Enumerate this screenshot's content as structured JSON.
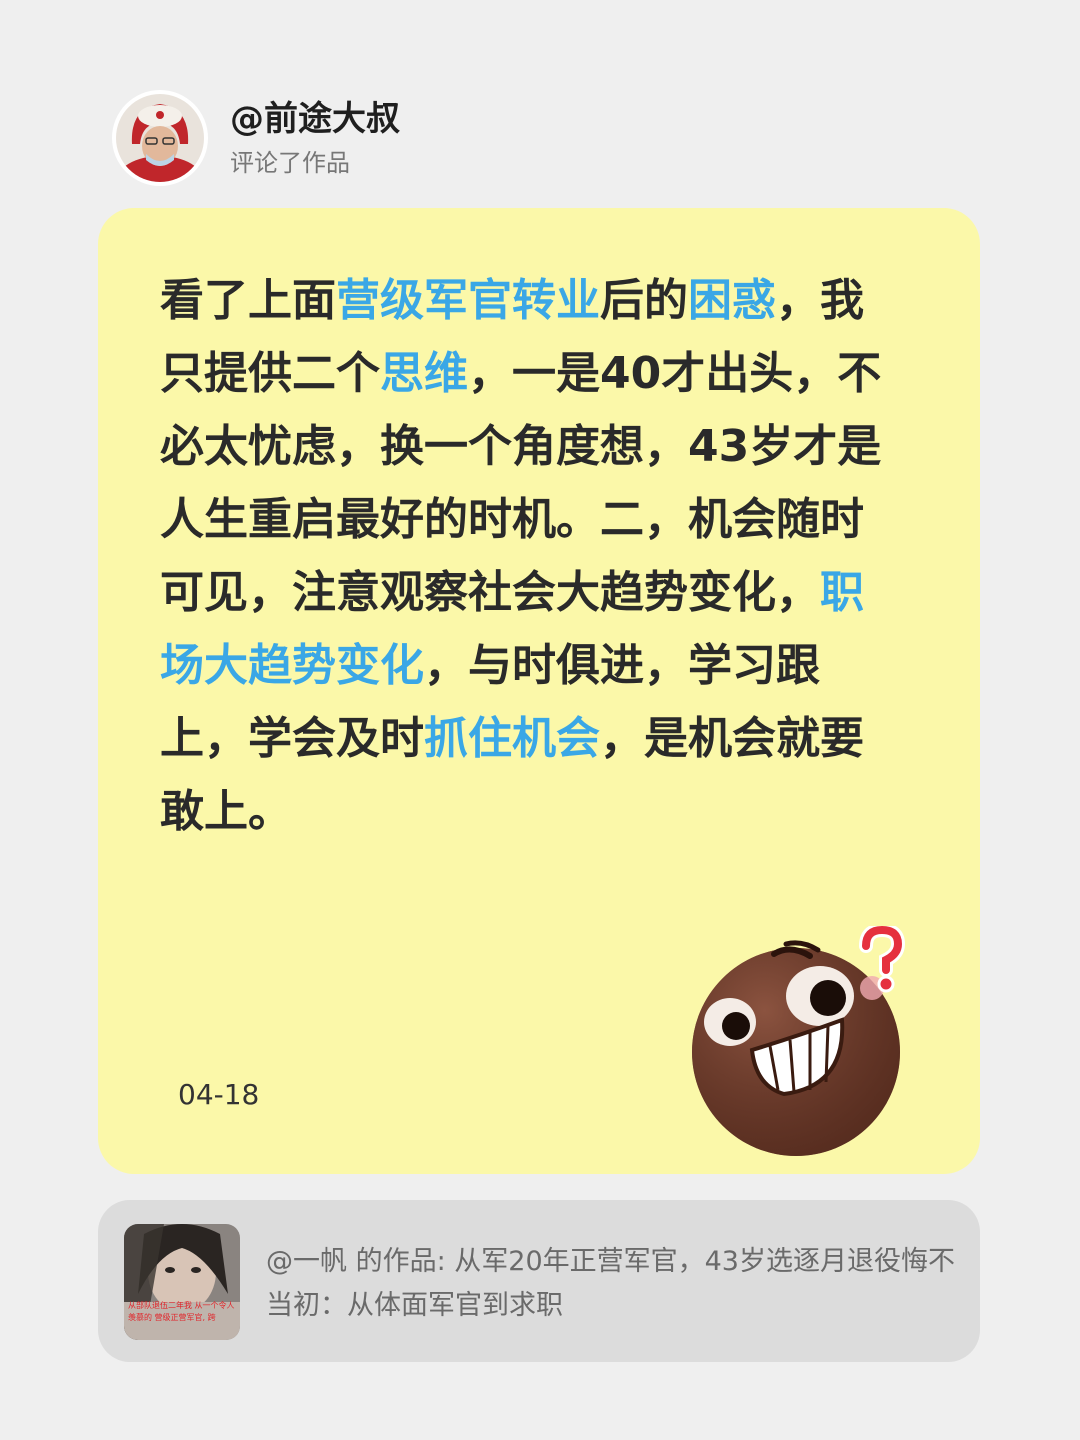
{
  "header": {
    "username": "@前途大叔",
    "action": "评论了作品"
  },
  "comment": {
    "segments": [
      {
        "text": "看了上面",
        "highlight": false
      },
      {
        "text": "营级军官转业",
        "highlight": true
      },
      {
        "text": "后的",
        "highlight": false
      },
      {
        "text": "困惑",
        "highlight": true
      },
      {
        "text": "，我只提供二个",
        "highlight": false
      },
      {
        "text": "思维",
        "highlight": true
      },
      {
        "text": "，一是40才出头，不必太忧虑，换一个角度想，43岁才是人生重启最好的时机。二，机会随时可见，注意观察社会大趋势变化，",
        "highlight": false
      },
      {
        "text": "职场大趋势变化",
        "highlight": true
      },
      {
        "text": "，与时俱进，学习跟上，学会及时",
        "highlight": false
      },
      {
        "text": "抓住机会",
        "highlight": true
      },
      {
        "text": "，是机会就要敢上。",
        "highlight": false
      }
    ],
    "date": "04-18",
    "sticker_icon": "grinning-confused-face-sticker",
    "highlight_color": "#3aa7e6",
    "card_color": "#fbf8a9"
  },
  "quoted_work": {
    "text": "@一帆 的作品: 从军20年正营军官，43岁选逐月退役悔不当初：从体面军官到求职",
    "thumbnail_caption": "从部队退伍二年我 从一个令人羡慕的 营级正营军官, 跨"
  }
}
